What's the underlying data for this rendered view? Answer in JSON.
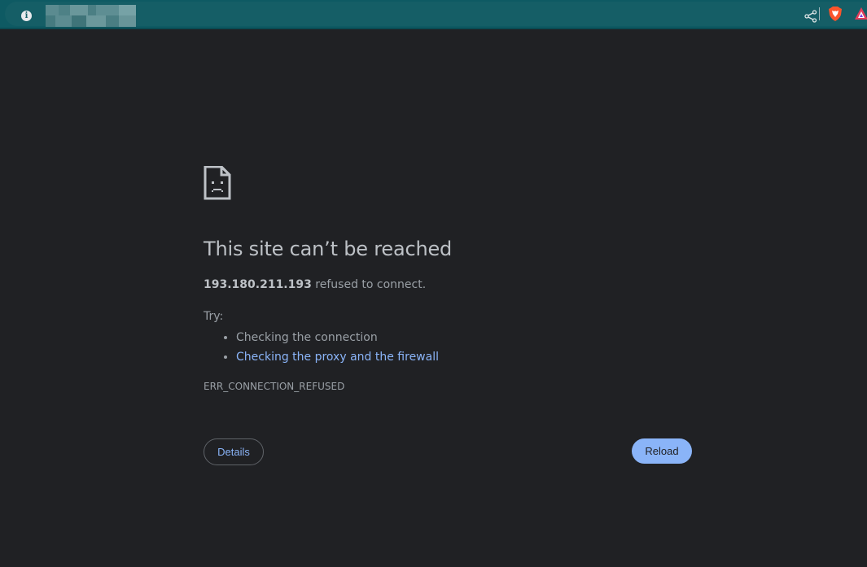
{
  "browser": {
    "icons": [
      "info-icon",
      "share-icon",
      "brave-shields-icon",
      "brave-rewards-icon"
    ]
  },
  "error_page": {
    "title": "This site can’t be reached",
    "host": "193.180.211.193",
    "refused_text": " refused to connect.",
    "try_label": "Try:",
    "suggestions": [
      "Checking the connection",
      "Checking the proxy and the firewall"
    ],
    "error_code": "ERR_CONNECTION_REFUSED",
    "details_label": "Details",
    "reload_label": "Reload"
  },
  "colors": {
    "background": "#202124",
    "toolbar": "#0e5a63",
    "link": "#8ab4f8",
    "text": "#9aa0a6"
  }
}
